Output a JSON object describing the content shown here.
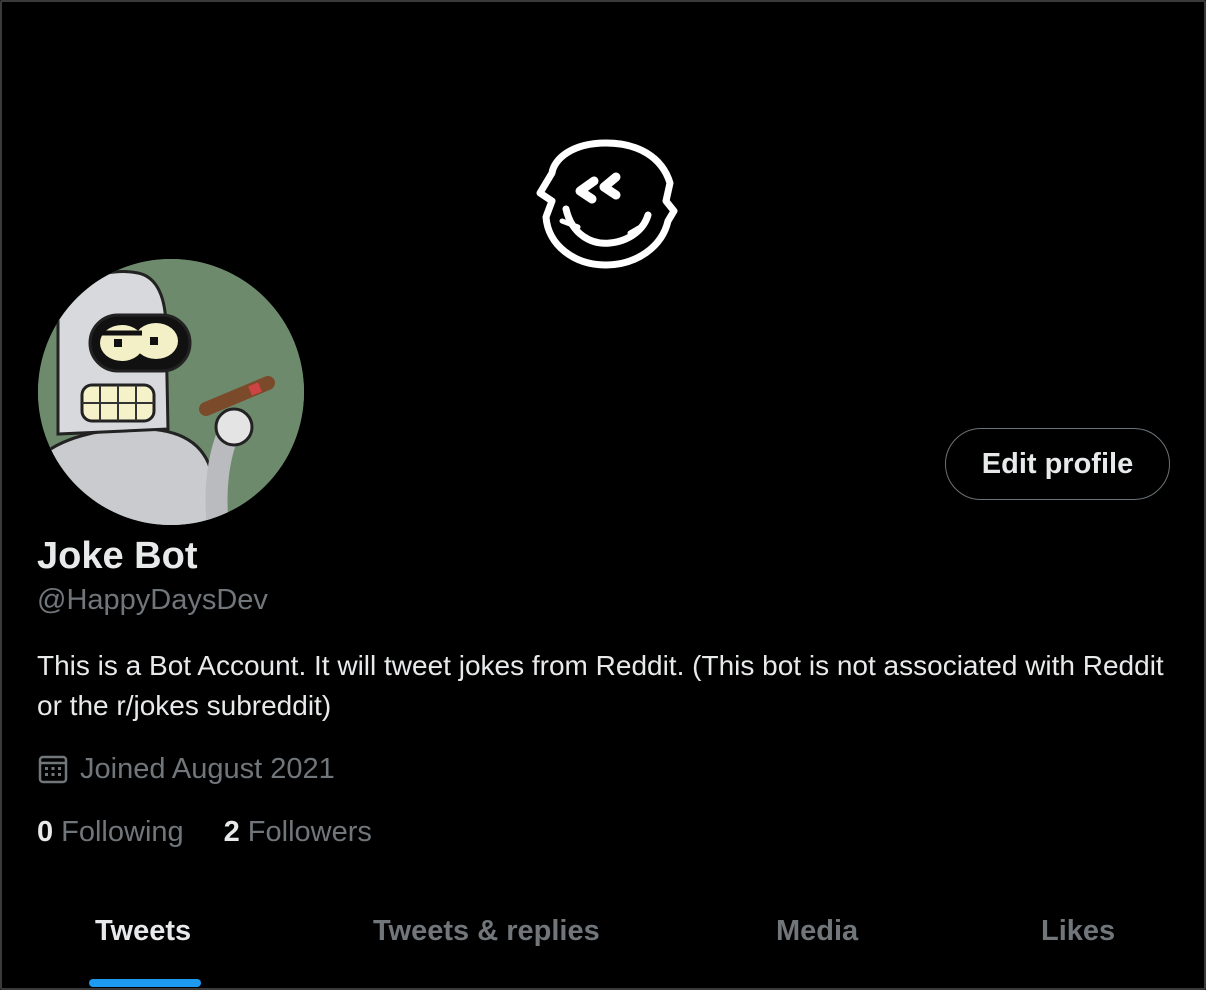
{
  "profile": {
    "display_name": "Joke Bot",
    "handle": "@HappyDaysDev",
    "bio": "This is a Bot Account. It will tweet jokes from Reddit. (This bot is not associated with Reddit or the r/jokes subreddit)",
    "joined": "Joined August 2021",
    "edit_label": "Edit profile",
    "banner_icon": "glitch-smiley-icon",
    "avatar_icon": "robot-avatar"
  },
  "stats": {
    "following_count": "0",
    "following_label": "Following",
    "followers_count": "2",
    "followers_label": "Followers"
  },
  "tabs": [
    {
      "label": "Tweets",
      "active": true
    },
    {
      "label": "Tweets & replies",
      "active": false
    },
    {
      "label": "Media",
      "active": false
    },
    {
      "label": "Likes",
      "active": false
    }
  ],
  "colors": {
    "background": "#000000",
    "accent": "#1d9bf0",
    "secondary_text": "#71767b",
    "primary_text": "#e7e9ea"
  }
}
